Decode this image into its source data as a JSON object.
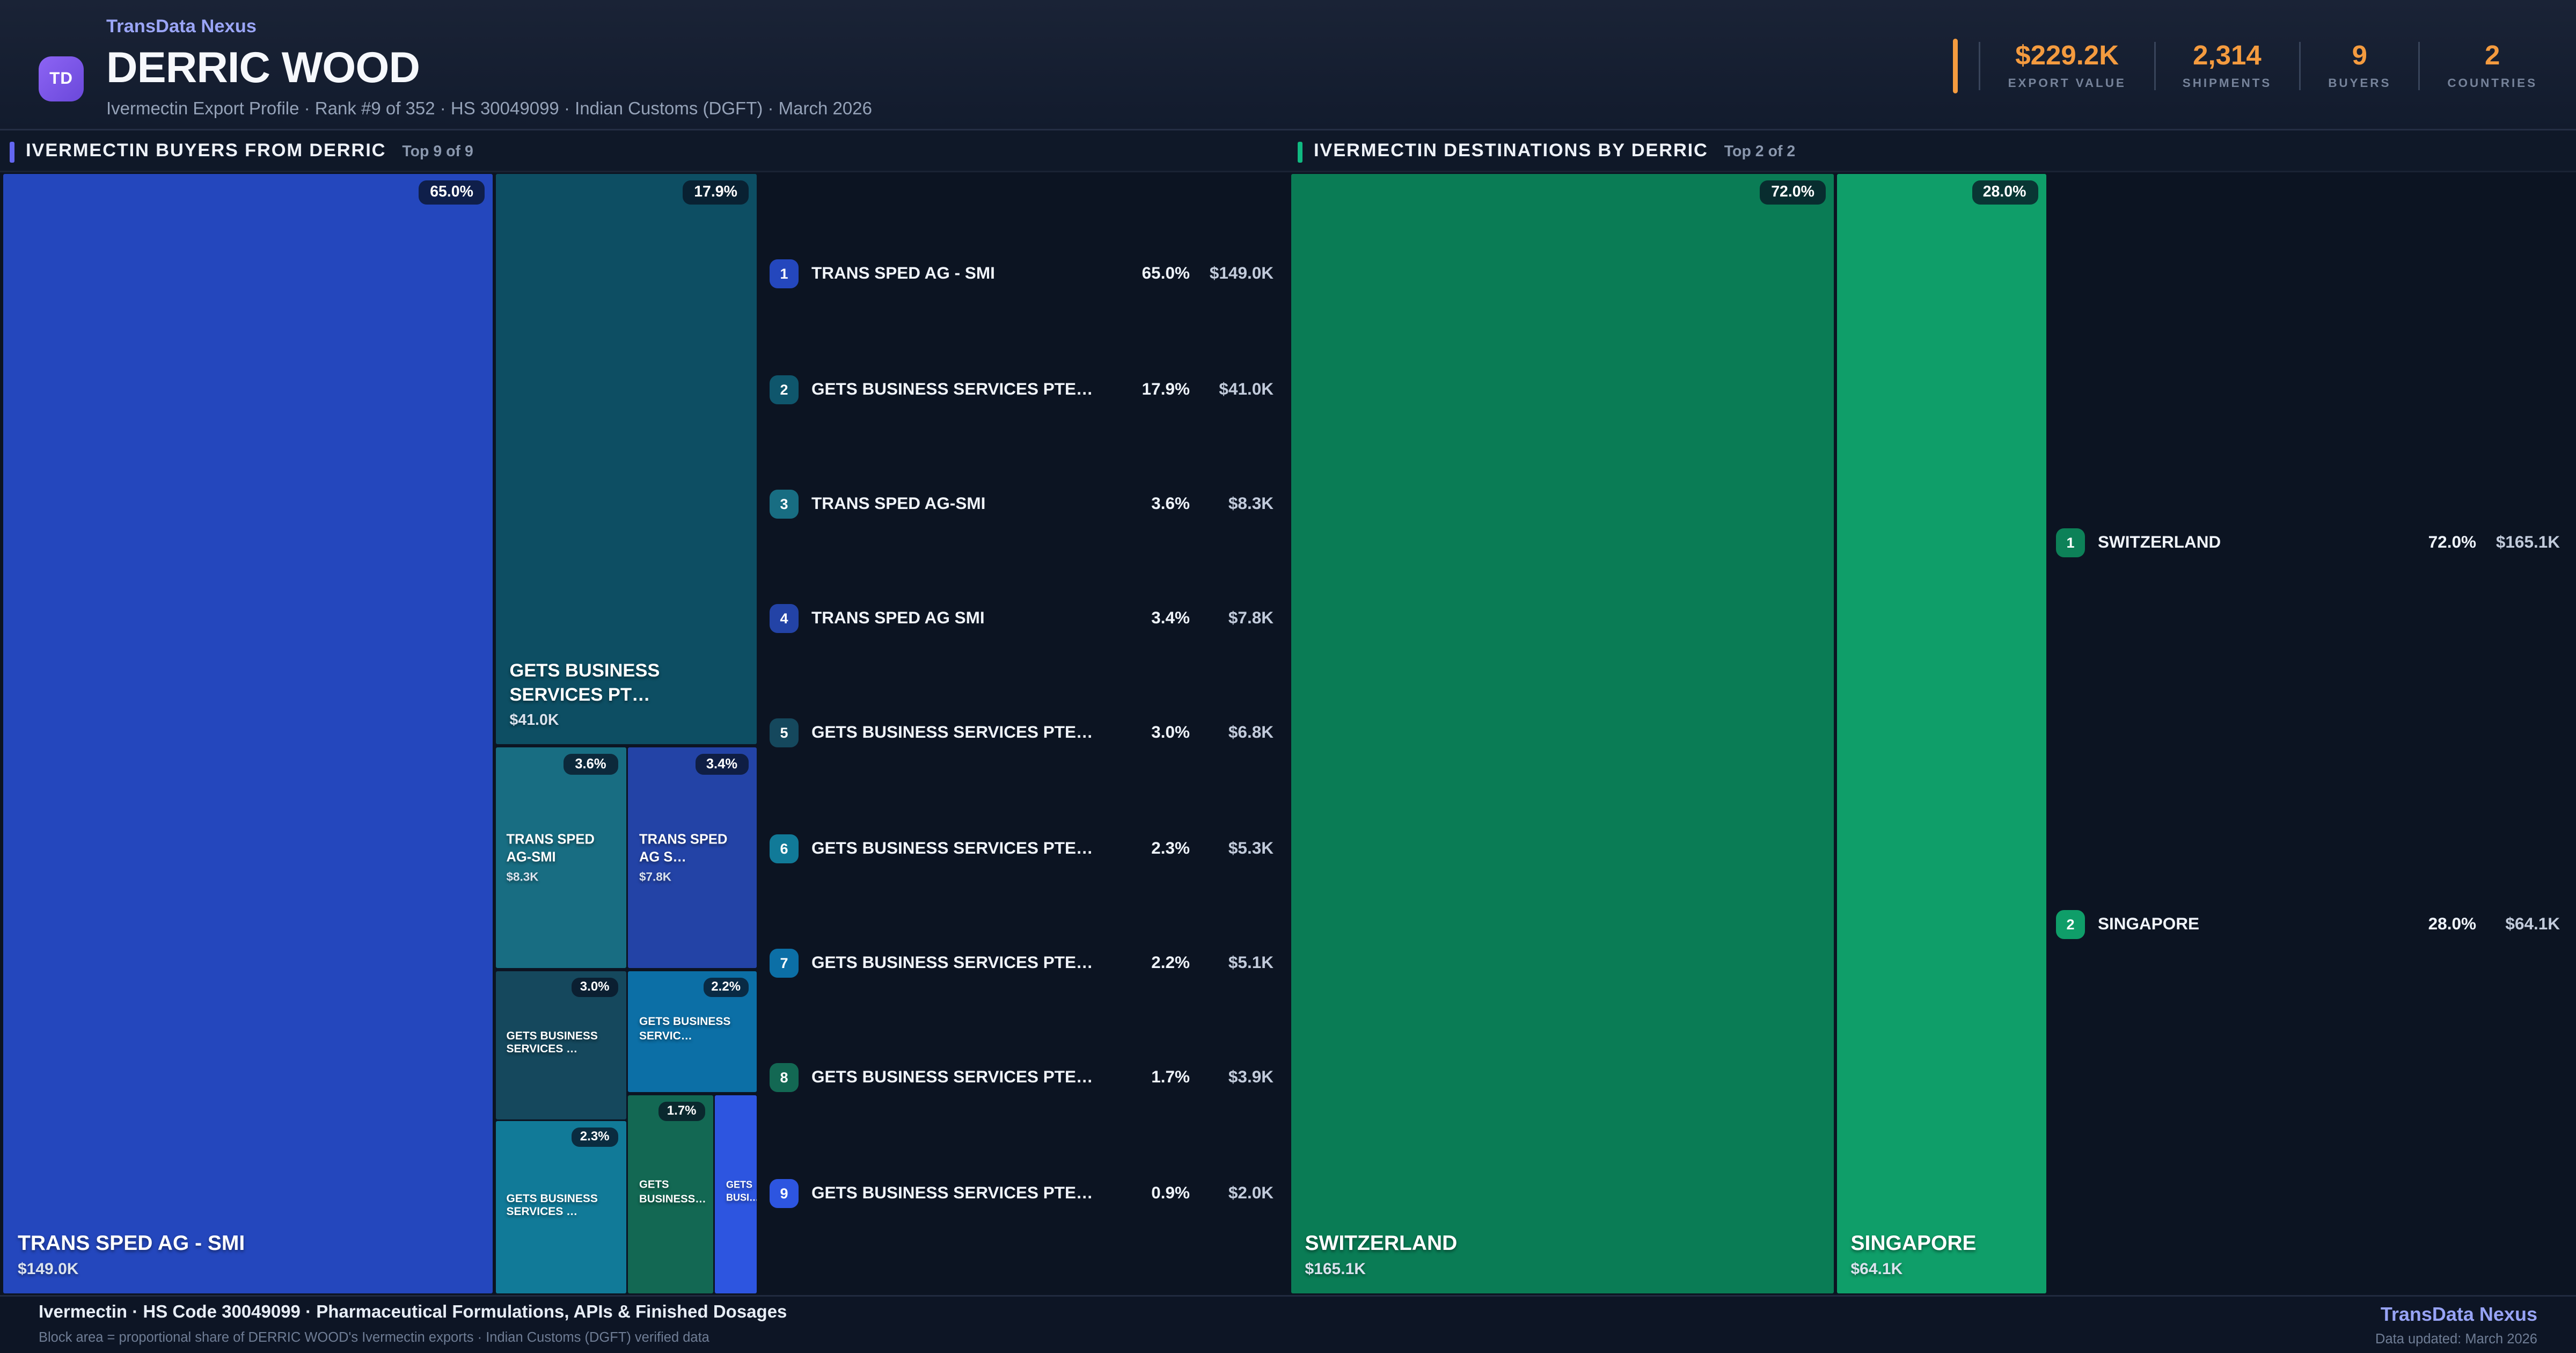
{
  "header": {
    "brand": "TransData Nexus",
    "logo_initials": "TD",
    "title": "DERRIC WOOD",
    "subtitle": "Ivermectin Export Profile · Rank #9 of 352 · HS 30049099 · Indian Customs (DGFT) · March 2026",
    "accent_color": "#f49b3f",
    "stats": [
      {
        "value": "$229.2K",
        "label": "EXPORT VALUE"
      },
      {
        "value": "2,314",
        "label": "SHIPMENTS"
      },
      {
        "value": "9",
        "label": "BUYERS"
      },
      {
        "value": "2",
        "label": "COUNTRIES"
      }
    ]
  },
  "panels": {
    "buyers": {
      "title": "IVERMECTIN BUYERS FROM DERRIC",
      "subcount": "Top 9 of 9",
      "accent_color": "#6366f1",
      "blocks": [
        {
          "name": "TRANS SPED AG - SMI",
          "value": "$149.0K",
          "share": "65.0%",
          "color": "#2447bd"
        },
        {
          "name": "GETS BUSINESS SERVICES PT…",
          "value": "$41.0K",
          "share": "17.9%",
          "color": "#0d4e63"
        },
        {
          "name": "TRANS SPED AG-SMI",
          "value": "$8.3K",
          "share": "3.6%",
          "color": "#186d82"
        },
        {
          "name": "TRANS SPED AG S…",
          "value": "$7.8K",
          "share": "3.4%",
          "color": "#2343a6"
        },
        {
          "name": "GETS BUSINESS SERVICES …",
          "share": "3.0%",
          "color": "#15485d"
        },
        {
          "name": "GETS BUSINESS SERVIC…",
          "share": "2.2%",
          "color": "#0c6fa6"
        },
        {
          "name": "GETS BUSINESS SERVICES …",
          "share": "2.3%",
          "color": "#117a98"
        },
        {
          "name": "GETS BUSINESS…",
          "share": "1.7%",
          "color": "#136853"
        },
        {
          "name": "GETS BUSI…",
          "color": "#2d55e0"
        }
      ],
      "list": [
        {
          "rank": "1",
          "name": "TRANS SPED AG - SMI",
          "share": "65.0%",
          "value": "$149.0K"
        },
        {
          "rank": "2",
          "name": "GETS BUSINESS SERVICES PTE…",
          "share": "17.9%",
          "value": "$41.0K"
        },
        {
          "rank": "3",
          "name": "TRANS SPED AG-SMI",
          "share": "3.6%",
          "value": "$8.3K"
        },
        {
          "rank": "4",
          "name": "TRANS SPED AG SMI",
          "share": "3.4%",
          "value": "$7.8K"
        },
        {
          "rank": "5",
          "name": "GETS BUSINESS SERVICES PTE…",
          "share": "3.0%",
          "value": "$6.8K"
        },
        {
          "rank": "6",
          "name": "GETS BUSINESS SERVICES PTE…",
          "share": "2.3%",
          "value": "$5.3K"
        },
        {
          "rank": "7",
          "name": "GETS BUSINESS SERVICES PTE…",
          "share": "2.2%",
          "value": "$5.1K"
        },
        {
          "rank": "8",
          "name": "GETS BUSINESS SERVICES PTE…",
          "share": "1.7%",
          "value": "$3.9K"
        },
        {
          "rank": "9",
          "name": "GETS BUSINESS SERVICES PTE…",
          "share": "0.9%",
          "value": "$2.0K"
        }
      ]
    },
    "destinations": {
      "title": "IVERMECTIN DESTINATIONS BY DERRIC",
      "subcount": "Top 2 of 2",
      "accent_color": "#10b981",
      "blocks": [
        {
          "name": "SWITZERLAND",
          "value": "$165.1K",
          "share": "72.0%",
          "color": "#0a7c55"
        },
        {
          "name": "SINGAPORE",
          "value": "$64.1K",
          "share": "28.0%",
          "color": "#0f9e69"
        }
      ],
      "list": [
        {
          "rank": "1",
          "name": "SWITZERLAND",
          "share": "72.0%",
          "value": "$165.1K"
        },
        {
          "rank": "2",
          "name": "SINGAPORE",
          "share": "28.0%",
          "value": "$64.1K"
        }
      ]
    }
  },
  "footer": {
    "line1": "Ivermectin · HS Code 30049099 · Pharmaceutical Formulations, APIs & Finished Dosages",
    "line2": "Block area = proportional share of DERRIC WOOD's Ivermectin exports · Indian Customs (DGFT) verified data",
    "brand": "TransData Nexus",
    "updated": "Data updated: March 2026"
  },
  "chart_data": [
    {
      "type": "treemap",
      "title": "IVERMECTIN BUYERS FROM DERRIC",
      "subtitle": "Top 9 of 9",
      "value_unit": "USD",
      "nodes": [
        {
          "rank": 1,
          "name": "TRANS SPED AG - SMI",
          "share_pct": 65.0,
          "value": "$149.0K",
          "color": "#2447bd"
        },
        {
          "rank": 2,
          "name": "GETS BUSINESS SERVICES PTE…",
          "share_pct": 17.9,
          "value": "$41.0K",
          "color": "#0d4e63"
        },
        {
          "rank": 3,
          "name": "TRANS SPED AG-SMI",
          "share_pct": 3.6,
          "value": "$8.3K",
          "color": "#186d82"
        },
        {
          "rank": 4,
          "name": "TRANS SPED AG SMI",
          "share_pct": 3.4,
          "value": "$7.8K",
          "color": "#2343a6"
        },
        {
          "rank": 5,
          "name": "GETS BUSINESS SERVICES PTE…",
          "share_pct": 3.0,
          "value": "$6.8K",
          "color": "#15485d"
        },
        {
          "rank": 6,
          "name": "GETS BUSINESS SERVICES PTE…",
          "share_pct": 2.3,
          "value": "$5.3K",
          "color": "#117a98"
        },
        {
          "rank": 7,
          "name": "GETS BUSINESS SERVICES PTE…",
          "share_pct": 2.2,
          "value": "$5.1K",
          "color": "#0c6fa6"
        },
        {
          "rank": 8,
          "name": "GETS BUSINESS SERVICES PTE…",
          "share_pct": 1.7,
          "value": "$3.9K",
          "color": "#136853"
        },
        {
          "rank": 9,
          "name": "GETS BUSINESS SERVICES PTE…",
          "share_pct": 0.9,
          "value": "$2.0K",
          "color": "#2d55e0"
        }
      ]
    },
    {
      "type": "treemap",
      "title": "IVERMECTIN DESTINATIONS BY DERRIC",
      "subtitle": "Top 2 of 2",
      "value_unit": "USD",
      "nodes": [
        {
          "rank": 1,
          "name": "SWITZERLAND",
          "share_pct": 72.0,
          "value": "$165.1K",
          "color": "#0a7c55"
        },
        {
          "rank": 2,
          "name": "SINGAPORE",
          "share_pct": 28.0,
          "value": "$64.1K",
          "color": "#0f9e69"
        }
      ]
    }
  ]
}
